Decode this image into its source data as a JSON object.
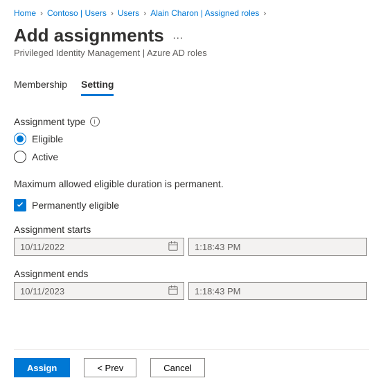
{
  "breadcrumb": {
    "items": [
      "Home",
      "Contoso | Users",
      "Users",
      "Alain Charon | Assigned roles"
    ]
  },
  "header": {
    "title": "Add assignments",
    "subtitle": "Privileged Identity Management | Azure AD roles"
  },
  "tabs": {
    "membership": "Membership",
    "setting": "Setting"
  },
  "assignment_type": {
    "label": "Assignment type",
    "eligible": "Eligible",
    "active": "Active"
  },
  "note": "Maximum allowed eligible duration is permanent.",
  "checkbox": {
    "label": "Permanently eligible"
  },
  "starts": {
    "label": "Assignment starts",
    "date": "10/11/2022",
    "time": "1:18:43 PM"
  },
  "ends": {
    "label": "Assignment ends",
    "date": "10/11/2023",
    "time": "1:18:43 PM"
  },
  "footer": {
    "assign": "Assign",
    "prev": "<  Prev",
    "cancel": "Cancel"
  }
}
